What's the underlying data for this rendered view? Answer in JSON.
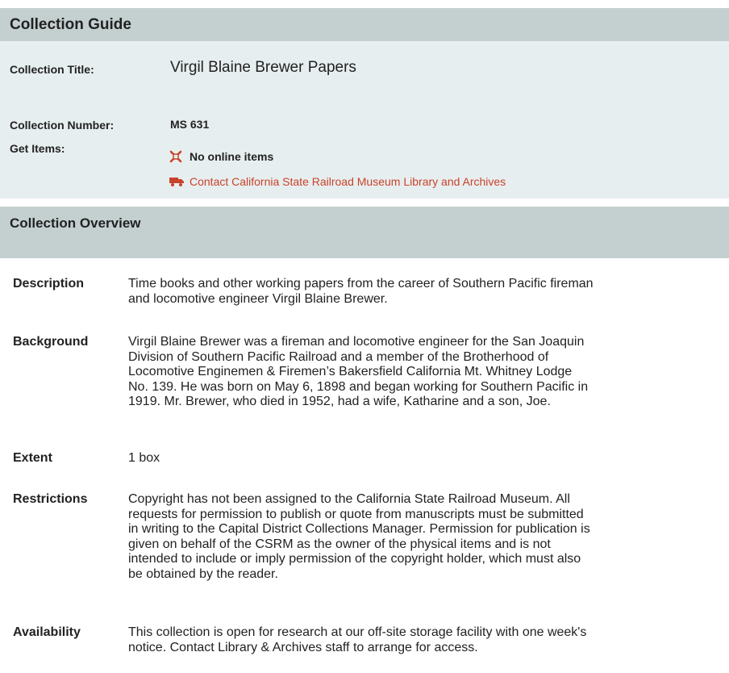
{
  "guide": {
    "header": "Collection Guide",
    "title_label": "Collection Title:",
    "title_value": "Virgil Blaine Brewer Papers",
    "number_label": "Collection Number:",
    "number_value": "MS 631",
    "get_items_label": "Get Items:",
    "no_online_items": "No online items",
    "contact_link": "Contact California State Railroad Museum Library and Archives"
  },
  "overview": {
    "header": "Collection Overview",
    "rows": [
      {
        "label": "Description",
        "lines": [
          "Time books and other working papers from the career of Southern Pacific fireman",
          "and locomotive engineer Virgil Blaine Brewer."
        ]
      },
      {
        "label": "Background",
        "lines": [
          "Virgil Blaine Brewer was a fireman and locomotive engineer for the San Joaquin",
          "Division of Southern Pacific Railroad and a member of the Brotherhood of",
          "Locomotive Enginemen & Firemen’s Bakersfield California Mt. Whitney Lodge",
          "No. 139. He was born on May 6, 1898 and began working for Southern Pacific in",
          "1919. Mr. Brewer, who died in 1952, had a wife, Katharine and a son, Joe."
        ]
      },
      {
        "label": "Extent",
        "lines": [
          "1 box"
        ]
      },
      {
        "label": "Restrictions",
        "lines": [
          "Copyright has not been assigned to the California State Railroad Museum. All",
          "requests for permission to publish or quote from manuscripts must be submitted",
          "in writing to the Capital District Collections Manager. Permission for publication is",
          "given on behalf of the CSRM as the owner of the physical items and is not",
          "intended to include or imply permission of the copyright holder, which must also",
          "be obtained by the reader."
        ]
      },
      {
        "label": "Availability",
        "lines": [
          "This collection is open for research at our off-site storage facility with one week's",
          "notice. Contact Library & Archives staff to arrange for access."
        ]
      }
    ]
  },
  "colors": {
    "header_bg": "#c4d0d0",
    "panel_bg": "#e7eeef",
    "link": "#c8432b"
  },
  "icons": {
    "no_items": "no-online-items-icon",
    "contact": "truck-icon"
  }
}
